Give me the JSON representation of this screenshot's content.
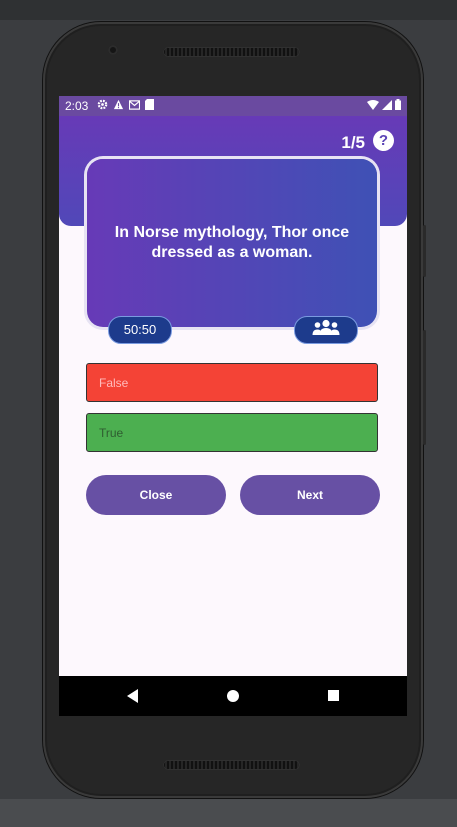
{
  "status_bar": {
    "time": "2:03",
    "left_icons": [
      "gear-icon",
      "warning-icon",
      "mail-icon",
      "sd-card-icon"
    ],
    "right_icons": [
      "wifi-icon",
      "signal-icon",
      "battery-icon"
    ]
  },
  "header": {
    "counter": "1/5",
    "help_label": "?"
  },
  "question": {
    "text": "In Norse mythology, Thor once dressed as a woman."
  },
  "lifelines": {
    "fifty_fifty": "50:50",
    "audience_icon": "people-group-icon"
  },
  "answers": [
    {
      "label": "False",
      "color": "#f44336"
    },
    {
      "label": "True",
      "color": "#4caf50"
    }
  ],
  "actions": {
    "close": "Close",
    "next": "Next"
  },
  "colors": {
    "primary": "#673ab7",
    "accent": "#3f51b5",
    "button": "#6750a4"
  },
  "nav": {
    "back_icon": "back-icon",
    "home_icon": "home-icon",
    "recents_icon": "recents-icon"
  }
}
